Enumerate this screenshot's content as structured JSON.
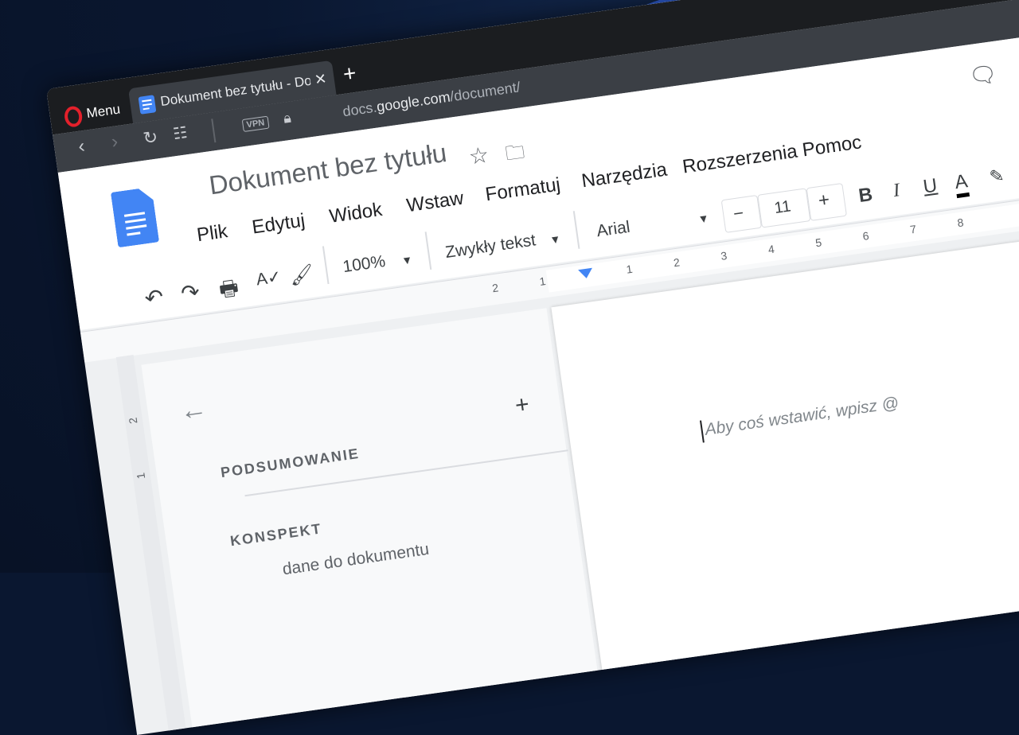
{
  "browser": {
    "menu_label": "Menu",
    "tab_title": "Dokument bez tytułu - Dok",
    "new_tab": "+",
    "close_tab": "×",
    "vpn": "VPN",
    "url_prefix": "docs.",
    "url_domain": "google.com",
    "url_path": "/document/"
  },
  "docs": {
    "title": "Dokument bez tytułu",
    "menu": [
      "Plik",
      "Edytuj",
      "Widok",
      "Wstaw",
      "Formatuj",
      "Narzędzia",
      "Rozszerzenia",
      "Pomoc"
    ],
    "toolbar": {
      "zoom": "100%",
      "style": "Zwykły tekst",
      "font": "Arial",
      "minus": "−",
      "font_size": "11",
      "plus": "+",
      "bold": "B",
      "italic": "I",
      "underline": "U",
      "text_color": "A"
    },
    "ruler": [
      "2",
      "1",
      "1",
      "2",
      "3",
      "4",
      "5",
      "6",
      "7",
      "8"
    ],
    "vruler": [
      "2",
      "1"
    ],
    "sidebar": {
      "summary": "PODSUMOWANIE",
      "outline": "KONSPEKT",
      "outline_hint": "dane do dokumentu",
      "add": "+"
    },
    "placeholder": "Aby coś wstawić, wpisz @"
  },
  "colors": {
    "accent": "#4285f4",
    "opera": "#e3202b"
  }
}
